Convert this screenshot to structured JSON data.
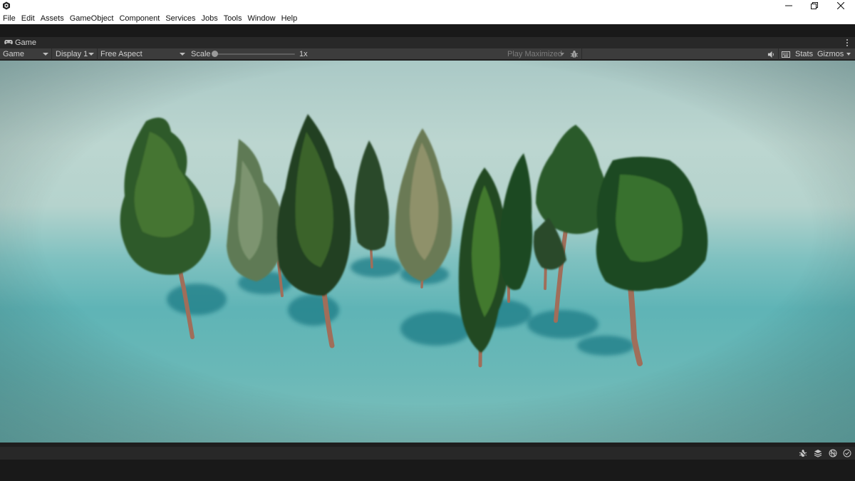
{
  "window": {
    "app_icon": "unity-logo-icon",
    "controls": [
      "minimize-icon",
      "restore-icon",
      "close-icon"
    ]
  },
  "menu": {
    "items": [
      "File",
      "Edit",
      "Assets",
      "GameObject",
      "Component",
      "Services",
      "Jobs",
      "Tools",
      "Window",
      "Help"
    ]
  },
  "tab": {
    "icon": "gamepad-icon",
    "label": "Game"
  },
  "toolbar": {
    "view_mode": "Game",
    "display": "Display 1",
    "aspect": "Free Aspect",
    "scale_label": "Scale",
    "scale_value": "1x",
    "scale_fraction": 0.0,
    "play_mode": "Play Maximized",
    "stats_label": "Stats",
    "gizmos_label": "Gizmos",
    "icons": [
      "bug-icon",
      "speaker-icon",
      "keyboard-icon"
    ]
  },
  "status": {
    "icons": [
      "debug-bug-icon",
      "layers-icon",
      "globe-bug-icon",
      "check-circle-icon"
    ]
  },
  "colors": {
    "accent_dark": "#282828",
    "toolbar": "#3c3c3c",
    "sky": "#bcd6d0",
    "ground": "#5fb4b6",
    "foliage": "#2f5a2a",
    "trunk": "#9a6a58"
  }
}
